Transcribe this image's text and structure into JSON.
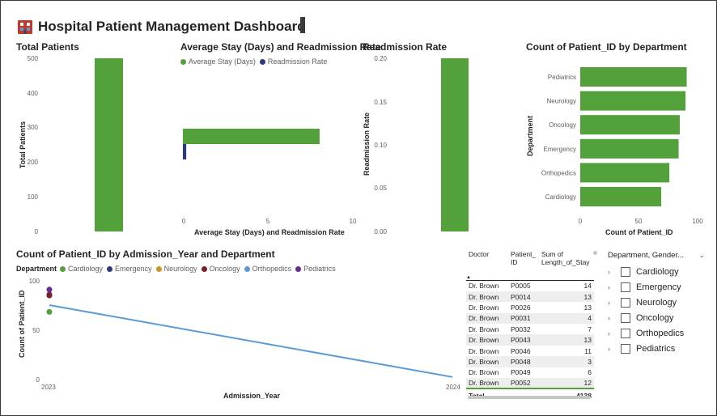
{
  "dashboard": {
    "title": "Hospital Patient Management Dashboard",
    "icon": "hospital-icon"
  },
  "colors": {
    "green": "#53a13b",
    "navy": "#2b3a7a",
    "gold": "#c39a28",
    "maroon": "#7a1f2b",
    "blue": "#5b9bd5",
    "purple": "#6b2a8e"
  },
  "visuals": {
    "total_patients": {
      "title": "Total Patients",
      "ylabel": "Total Patients",
      "ticks": [
        "500",
        "400",
        "300",
        "200",
        "100",
        "0"
      ]
    },
    "avg_stay": {
      "title": "Average Stay (Days) and Readmission Rate",
      "legend": [
        "Average Stay (Days)",
        "Readmission Rate"
      ],
      "xticks": [
        "0",
        "5",
        "10"
      ],
      "xlabel": "Average Stay (Days) and Readmission Rate"
    },
    "readmission": {
      "title": "Readmission Rate",
      "ylabel": "Readmission Rate",
      "ticks": [
        "0.20",
        "0.15",
        "0.10",
        "0.05",
        "0.00"
      ]
    },
    "dept_count": {
      "title": "Count of Patient_ID by Department",
      "ylabel": "Department",
      "xlabel": "Count of Patient_ID",
      "xticks": [
        "0",
        "50",
        "100"
      ]
    },
    "year_dept": {
      "title": "Count of Patient_ID by Admission_Year and Department",
      "legend_title": "Department",
      "legend": [
        "Cardiology",
        "Emergency",
        "Neurology",
        "Oncology",
        "Orthopedics",
        "Pediatrics"
      ],
      "ylabel": "Count of Patient_ID",
      "xlabel": "Admission_Year",
      "yticks": [
        "100",
        "50",
        "0"
      ],
      "xticks": [
        "2023",
        "2024"
      ]
    }
  },
  "chart_data": [
    {
      "type": "bar",
      "title": "Total Patients",
      "ylabel": "Total Patients",
      "ylim": [
        0,
        500
      ],
      "categories": [
        ""
      ],
      "values": [
        500
      ]
    },
    {
      "type": "bar",
      "orientation": "horizontal",
      "title": "Average Stay (Days) and Readmission Rate",
      "xlabel": "Average Stay (Days) and Readmission Rate",
      "xlim": [
        0,
        10
      ],
      "series": [
        {
          "name": "Average Stay (Days)",
          "values": [
            8.2
          ]
        },
        {
          "name": "Readmission Rate",
          "values": [
            0.2
          ]
        }
      ]
    },
    {
      "type": "bar",
      "title": "Readmission Rate",
      "ylabel": "Readmission Rate",
      "ylim": [
        0,
        0.2
      ],
      "categories": [
        ""
      ],
      "values": [
        0.2
      ]
    },
    {
      "type": "bar",
      "orientation": "horizontal",
      "title": "Count of Patient_ID by Department",
      "xlabel": "Count of Patient_ID",
      "ylabel": "Department",
      "xlim": [
        0,
        100
      ],
      "categories": [
        "Pediatrics",
        "Neurology",
        "Oncology",
        "Emergency",
        "Orthopedics",
        "Cardiology"
      ],
      "values": [
        92,
        91,
        86,
        85,
        77,
        70
      ]
    },
    {
      "type": "line",
      "title": "Count of Patient_ID by Admission_Year and Department",
      "xlabel": "Admission_Year",
      "ylabel": "Count of Patient_ID",
      "ylim": [
        0,
        100
      ],
      "x": [
        "2023",
        "2024"
      ],
      "series": [
        {
          "name": "Cardiology",
          "values": [
            68,
            null
          ]
        },
        {
          "name": "Emergency",
          "values": [
            86,
            null
          ]
        },
        {
          "name": "Neurology",
          "values": [
            85,
            null
          ]
        },
        {
          "name": "Oncology",
          "values": [
            85,
            null
          ]
        },
        {
          "name": "Orthopedics",
          "values": [
            75,
            1
          ]
        },
        {
          "name": "Pediatrics",
          "values": [
            91,
            null
          ]
        }
      ]
    }
  ],
  "table": {
    "headers": [
      "Doctor",
      "Patient_ ID",
      "Sum of Length_of_Stay"
    ],
    "rows": [
      [
        "Dr. Brown",
        "P0005",
        "14"
      ],
      [
        "Dr. Brown",
        "P0014",
        "13"
      ],
      [
        "Dr. Brown",
        "P0026",
        "13"
      ],
      [
        "Dr. Brown",
        "P0031",
        "4"
      ],
      [
        "Dr. Brown",
        "P0032",
        "7"
      ],
      [
        "Dr. Brown",
        "P0043",
        "13"
      ],
      [
        "Dr. Brown",
        "P0046",
        "11"
      ],
      [
        "Dr. Brown",
        "P0048",
        "3"
      ],
      [
        "Dr. Brown",
        "P0049",
        "6"
      ],
      [
        "Dr. Brown",
        "P0052",
        "12"
      ]
    ],
    "total_label": "Total",
    "total_value": "4138"
  },
  "slicer": {
    "header": "Department, Gender...",
    "items": [
      "Cardiology",
      "Emergency",
      "Neurology",
      "Oncology",
      "Orthopedics",
      "Pediatrics"
    ]
  }
}
